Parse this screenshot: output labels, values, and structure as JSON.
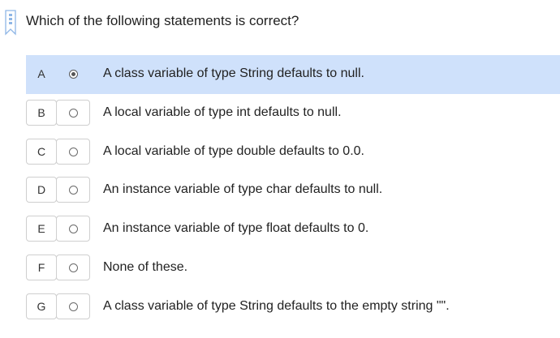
{
  "question": {
    "text": "Which of the following statements is correct?",
    "icon": "bookmark-icon"
  },
  "options": [
    {
      "letter": "A",
      "text": "A class variable of type String defaults to null.",
      "selected": true
    },
    {
      "letter": "B",
      "text": "A local variable of type int defaults to null.",
      "selected": false
    },
    {
      "letter": "C",
      "text": "A local variable of type double defaults to 0.0.",
      "selected": false
    },
    {
      "letter": "D",
      "text": "An instance variable of type char defaults to null.",
      "selected": false
    },
    {
      "letter": "E",
      "text": "An instance variable of type float defaults to 0.",
      "selected": false
    },
    {
      "letter": "F",
      "text": "None of these.",
      "selected": false
    },
    {
      "letter": "G",
      "text": "A class variable of type String defaults to the empty string \"\".",
      "selected": false
    }
  ],
  "colors": {
    "selected_background": "#cfe1fb",
    "bookmark_accent": "#8fb6e6"
  }
}
